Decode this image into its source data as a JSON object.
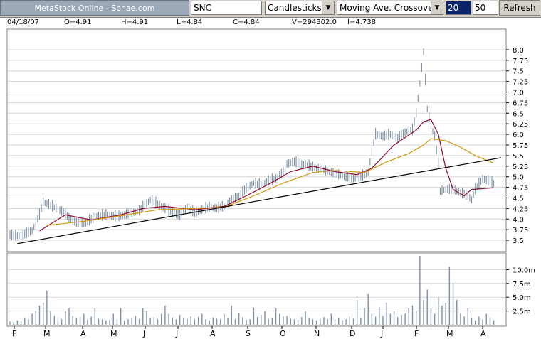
{
  "toolbar": {
    "brand": "MetaStock Online - Sonae.com",
    "ticker": "SNC",
    "chart_style": "Candlesticks",
    "indicator": "Moving Ave. Crossover",
    "period_fast": "20",
    "period_slow": "50",
    "refresh_label": "Refresh"
  },
  "info": {
    "date": "04/18/07",
    "open": "O=4.91",
    "high": "H=4.91",
    "low": "L=4.84",
    "close": "C=4.84",
    "volume": "V=294302.0",
    "indicator": "I=4.738"
  },
  "colors": {
    "price": "#7f8fa4",
    "ma_fast": "#8b0a2a",
    "ma_slow": "#d4960a",
    "trendline": "#000000",
    "grid": "#d6d6d6"
  },
  "chart_data": [
    {
      "type": "line",
      "y_ticks": [
        "8.0",
        "7.75",
        "7.5",
        "7.25",
        "7.0",
        "6.75",
        "6.5",
        "6.25",
        "6.0",
        "5.75",
        "5.5",
        "5.25",
        "5.0",
        "4.75",
        "4.5",
        "4.25",
        "4.0",
        "3.75",
        "3.5"
      ],
      "ylim": [
        3.3,
        8.2
      ],
      "x_ticks": [
        "F",
        "M",
        "A",
        "M",
        "J",
        "J",
        "A",
        "S",
        "O",
        "N",
        "D",
        "J",
        "F",
        "M",
        "A"
      ],
      "price_points": [
        [
          0,
          3.62
        ],
        [
          3,
          3.6
        ],
        [
          6,
          3.72
        ],
        [
          8,
          4.1
        ],
        [
          9,
          4.4
        ],
        [
          11,
          4.32
        ],
        [
          14,
          4.18
        ],
        [
          17,
          3.95
        ],
        [
          20,
          3.88
        ],
        [
          23,
          4.05
        ],
        [
          26,
          4.1
        ],
        [
          29,
          4.05
        ],
        [
          32,
          4.12
        ],
        [
          35,
          4.2
        ],
        [
          38,
          4.45
        ],
        [
          40,
          4.35
        ],
        [
          42,
          4.25
        ],
        [
          44,
          4.15
        ],
        [
          46,
          4.08
        ],
        [
          48,
          4.28
        ],
        [
          50,
          4.15
        ],
        [
          52,
          4.22
        ],
        [
          54,
          4.28
        ],
        [
          56,
          4.25
        ],
        [
          58,
          4.3
        ],
        [
          62,
          4.55
        ],
        [
          64,
          4.72
        ],
        [
          66,
          4.85
        ],
        [
          68,
          4.8
        ],
        [
          70,
          4.9
        ],
        [
          72,
          4.95
        ],
        [
          74,
          5.1
        ],
        [
          75,
          5.3
        ],
        [
          77,
          5.35
        ],
        [
          79,
          5.3
        ],
        [
          81,
          5.25
        ],
        [
          83,
          5.2
        ],
        [
          85,
          5.15
        ],
        [
          87,
          5.1
        ],
        [
          89,
          5.05
        ],
        [
          91,
          5.0
        ],
        [
          93,
          4.95
        ],
        [
          95,
          5.0
        ],
        [
          97,
          5.1
        ],
        [
          98,
          5.6
        ],
        [
          99,
          6.0
        ],
        [
          101,
          5.95
        ],
        [
          103,
          6.0
        ],
        [
          105,
          5.9
        ],
        [
          107,
          6.05
        ],
        [
          109,
          6.1
        ],
        [
          110,
          6.5
        ],
        [
          111,
          7.2
        ],
        [
          112,
          7.95
        ],
        [
          113,
          6.6
        ],
        [
          114,
          6.2
        ],
        [
          115,
          5.95
        ],
        [
          116,
          5.3
        ],
        [
          116.5,
          4.65
        ],
        [
          118,
          4.7
        ],
        [
          120,
          4.7
        ],
        [
          122,
          4.62
        ],
        [
          124,
          4.55
        ],
        [
          125,
          4.45
        ],
        [
          126,
          4.7
        ],
        [
          128,
          4.95
        ],
        [
          130,
          4.88
        ],
        [
          131,
          4.84
        ]
      ],
      "series": [
        {
          "points": [
            [
              8,
              3.72
            ],
            [
              15,
              4.1
            ],
            [
              22,
              3.98
            ],
            [
              30,
              4.1
            ],
            [
              36,
              4.25
            ],
            [
              42,
              4.3
            ],
            [
              50,
              4.22
            ],
            [
              58,
              4.3
            ],
            [
              64,
              4.55
            ],
            [
              70,
              4.82
            ],
            [
              76,
              5.12
            ],
            [
              82,
              5.25
            ],
            [
              88,
              5.12
            ],
            [
              94,
              5.05
            ],
            [
              98,
              5.2
            ],
            [
              104,
              5.75
            ],
            [
              110,
              6.1
            ],
            [
              112,
              6.3
            ],
            [
              114,
              6.35
            ],
            [
              116,
              6.0
            ],
            [
              118,
              5.2
            ],
            [
              120,
              4.7
            ],
            [
              123,
              4.55
            ],
            [
              125,
              4.7
            ],
            [
              131,
              4.74
            ]
          ]
        },
        {
          "points": [
            [
              10,
              3.85
            ],
            [
              20,
              3.95
            ],
            [
              30,
              4.08
            ],
            [
              40,
              4.22
            ],
            [
              50,
              4.25
            ],
            [
              58,
              4.28
            ],
            [
              66,
              4.55
            ],
            [
              74,
              4.85
            ],
            [
              82,
              5.1
            ],
            [
              88,
              5.15
            ],
            [
              96,
              5.1
            ],
            [
              102,
              5.35
            ],
            [
              108,
              5.55
            ],
            [
              112,
              5.75
            ],
            [
              114,
              5.9
            ],
            [
              118,
              5.85
            ],
            [
              122,
              5.7
            ],
            [
              126,
              5.5
            ],
            [
              131,
              5.32
            ]
          ]
        },
        {
          "points": [
            [
              2,
              3.42
            ],
            [
              133,
              5.45
            ]
          ]
        }
      ]
    },
    {
      "type": "bar",
      "y_ticks": [
        "10.0m",
        "7.5m",
        "5.0m",
        "2.5m"
      ],
      "ylim": [
        0,
        12.5
      ],
      "volumes": [
        0.6,
        0.5,
        0.8,
        0.7,
        1.2,
        1.0,
        2.0,
        2.6,
        3.5,
        4.0,
        6.2,
        2.5,
        1.6,
        1.2,
        1.0,
        2.5,
        3.0,
        1.6,
        1.2,
        1.4,
        2.0,
        0.9,
        1.5,
        3.0,
        1.1,
        1.0,
        0.8,
        0.9,
        2.0,
        1.1,
        3.0,
        0.8,
        1.0,
        1.2,
        1.6,
        1.0,
        3.0,
        2.5,
        1.2,
        1.4,
        1.0,
        2.0,
        3.5,
        2.0,
        1.3,
        1.0,
        1.8,
        1.2,
        1.1,
        1.5,
        1.0,
        1.4,
        2.0,
        1.0,
        0.8,
        1.3,
        1.1,
        1.0,
        1.9,
        1.2,
        3.5,
        1.0,
        2.2,
        1.4,
        0.9,
        1.0,
        3.1,
        1.4,
        1.8,
        2.5,
        1.0,
        1.2,
        3.0,
        2.0,
        1.5,
        1.6,
        1.1,
        1.0,
        0.9,
        1.4,
        2.5,
        1.2,
        1.0,
        0.8,
        1.1,
        1.4,
        1.0,
        2.0,
        1.0,
        1.2,
        0.8,
        1.0,
        1.5,
        1.1,
        4.5,
        1.2,
        3.0,
        5.6,
        2.0,
        1.5,
        3.2,
        1.6,
        4.0,
        2.0,
        2.5,
        1.4,
        1.8,
        2.0,
        3.0,
        3.5,
        2.5,
        12.5,
        4.5,
        6.4,
        3.0,
        2.0,
        5.0,
        3.5,
        4.0,
        10.5,
        7.5,
        4.5,
        2.0,
        1.5,
        3.0,
        1.2,
        0.8,
        1.5,
        1.0,
        2.0,
        1.2,
        0.8
      ]
    }
  ]
}
